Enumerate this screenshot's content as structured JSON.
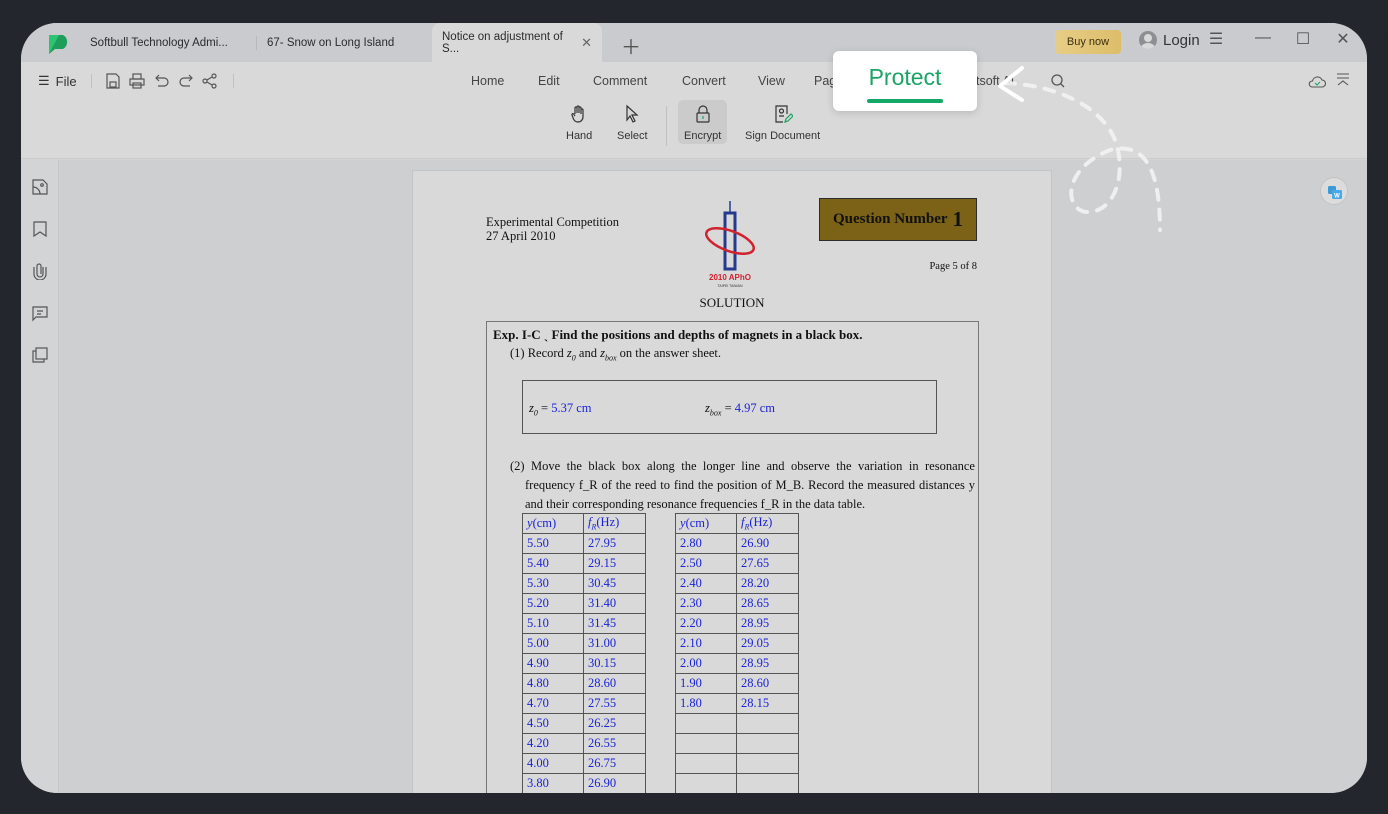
{
  "app": {
    "tabs": [
      {
        "label": "Softbull Technology Admi...",
        "active": false
      },
      {
        "label": "67- Snow on Long Island",
        "active": false
      },
      {
        "label": "Notice on adjustment of S...",
        "active": true
      }
    ],
    "buy_now": "Buy now",
    "login": "Login"
  },
  "menu": {
    "file": "File",
    "nav": [
      "Home",
      "Edit",
      "Comment",
      "Convert",
      "View",
      "Page",
      "Protect",
      "Afirstsoft AI"
    ],
    "active_nav": "Protect"
  },
  "ribbon": {
    "tools": [
      {
        "label": "Hand",
        "icon": "hand-icon"
      },
      {
        "label": "Select",
        "icon": "cursor-icon"
      },
      {
        "label": "Encrypt",
        "icon": "lock-icon",
        "selected": true
      },
      {
        "label": "Sign Document",
        "icon": "sign-document-icon"
      }
    ]
  },
  "callout": {
    "label": "Protect",
    "accent": "#1aa566"
  },
  "document": {
    "header_left": [
      "Experimental Competition",
      "27 April 2010"
    ],
    "logo_text": "2010 APhO",
    "logo_sub": "TAIPEI   TAIWAN",
    "question_label": "Question Number",
    "question_number": "1",
    "page_label": "Page 5 of 8",
    "solution": "SOLUTION",
    "exp_title": "Exp. I-C ˎ Find the positions and depths of magnets in a black box.",
    "q1_text": "(1) Record z₀ and z_box on the answer sheet.",
    "q1_pre": "(1) Record ",
    "q1_z0": "z",
    "q1_and": " and ",
    "q1_zbox": "z",
    "q1_post": " on the answer sheet.",
    "z0_label": "z",
    "z0_value": "5.37 cm",
    "zbox_label": "z",
    "zbox_value": "4.97 cm",
    "q2_line1": "(2) Move the black box along the longer line and observe the variation in resonance",
    "q2_line2": "frequency f_R of the reed to find the position of M_B. Record the measured distances y",
    "q2_line3": "and their corresponding resonance frequencies f_R in the data table.",
    "table_headers": [
      "y(cm)",
      "fR(Hz)"
    ],
    "table_left": [
      [
        "5.50",
        "27.95"
      ],
      [
        "5.40",
        "29.15"
      ],
      [
        "5.30",
        "30.45"
      ],
      [
        "5.20",
        "31.40"
      ],
      [
        "5.10",
        "31.45"
      ],
      [
        "5.00",
        "31.00"
      ],
      [
        "4.90",
        "30.15"
      ],
      [
        "4.80",
        "28.60"
      ],
      [
        "4.70",
        "27.55"
      ],
      [
        "4.50",
        "26.25"
      ],
      [
        "4.20",
        "26.55"
      ],
      [
        "4.00",
        "26.75"
      ],
      [
        "3.80",
        "26.90"
      ]
    ],
    "table_right": [
      [
        "2.80",
        "26.90"
      ],
      [
        "2.50",
        "27.65"
      ],
      [
        "2.40",
        "28.20"
      ],
      [
        "2.30",
        "28.65"
      ],
      [
        "2.20",
        "28.95"
      ],
      [
        "2.10",
        "29.05"
      ],
      [
        "2.00",
        "28.95"
      ],
      [
        "1.90",
        "28.60"
      ],
      [
        "1.80",
        "28.15"
      ],
      [
        "",
        ""
      ],
      [
        "",
        ""
      ],
      [
        "",
        ""
      ],
      [
        "",
        ""
      ]
    ]
  }
}
